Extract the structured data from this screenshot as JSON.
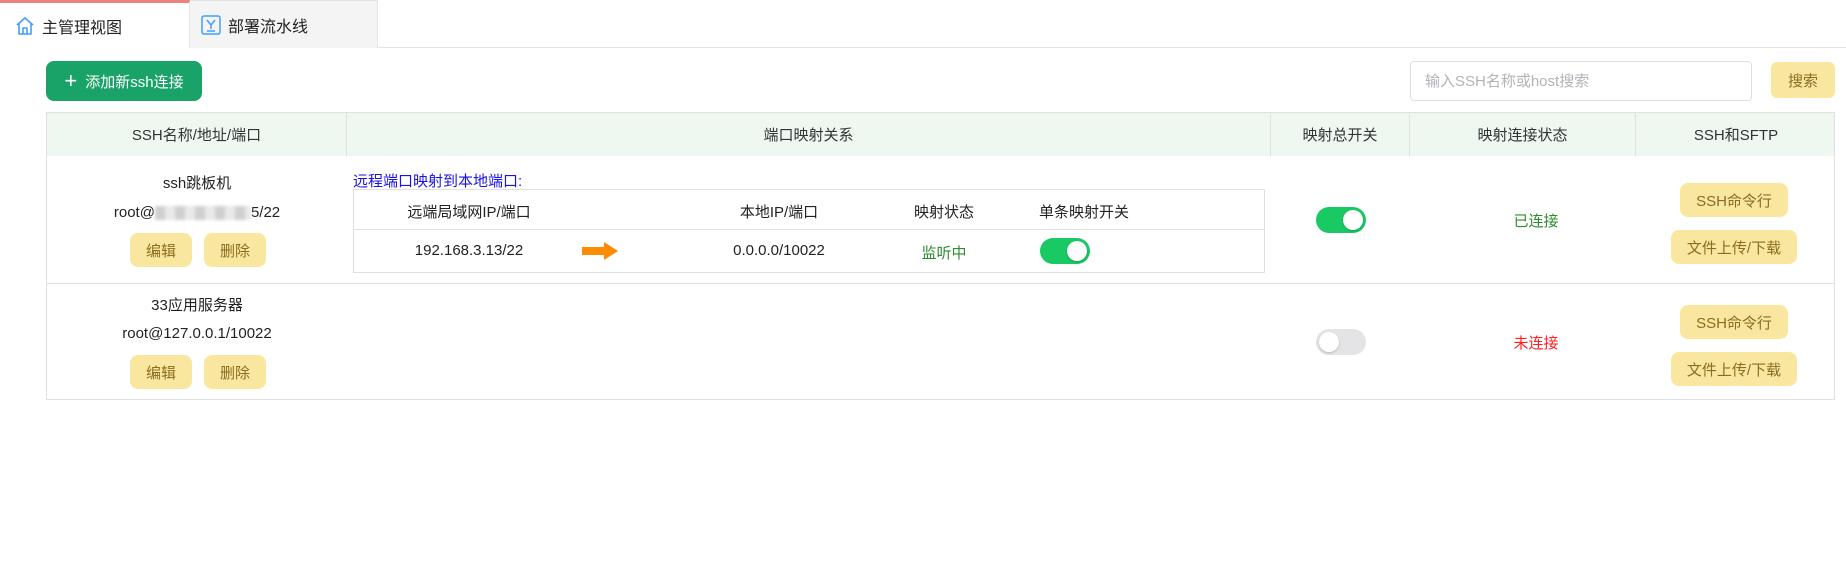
{
  "tabs": [
    {
      "label": "主管理视图",
      "icon": "home-icon",
      "active": true
    },
    {
      "label": "部署流水线",
      "icon": "pipeline-icon",
      "active": false
    }
  ],
  "toolbar": {
    "add_label": "添加新ssh连接",
    "search_placeholder": "输入SSH名称或host搜索",
    "search_label": "搜索"
  },
  "table": {
    "headers": [
      "SSH名称/地址/端口",
      "端口映射关系",
      "映射总开关",
      "映射连接状态",
      "SSH和SFTP"
    ],
    "rows": [
      {
        "name": "ssh跳板机",
        "address_prefix": "root@",
        "address_suffix": "5/22",
        "edit_label": "编辑",
        "delete_label": "删除",
        "mapping": {
          "caption": "远程端口映射到本地端口:",
          "headers": [
            "远端局域网IP/端口",
            "本地IP/端口",
            "映射状态",
            "单条映射开关"
          ],
          "items": [
            {
              "remote": "192.168.3.13/22",
              "local": "0.0.0.0/10022",
              "status": "监听中",
              "enabled": true
            }
          ]
        },
        "master_switch": true,
        "conn_status": "已连接",
        "ssh_label": "SSH命令行",
        "sftp_label": "文件上传/下载"
      },
      {
        "name": "33应用服务器",
        "address": "root@127.0.0.1/10022",
        "edit_label": "编辑",
        "delete_label": "删除",
        "master_switch": false,
        "conn_status": "未连接",
        "ssh_label": "SSH命令行",
        "sftp_label": "文件上传/下载"
      }
    ]
  },
  "colors": {
    "primary": "#1aa368",
    "header_bg": "#eef8f1",
    "toggle_on": "#18c964",
    "button_yellow": "#f9e79f",
    "connected": "#2e8b2e",
    "disconnected": "#ff1f1f",
    "listening": "#2e8b2e",
    "caption_blue": "#1a12e6",
    "arrow_orange": "#ff8c00"
  }
}
